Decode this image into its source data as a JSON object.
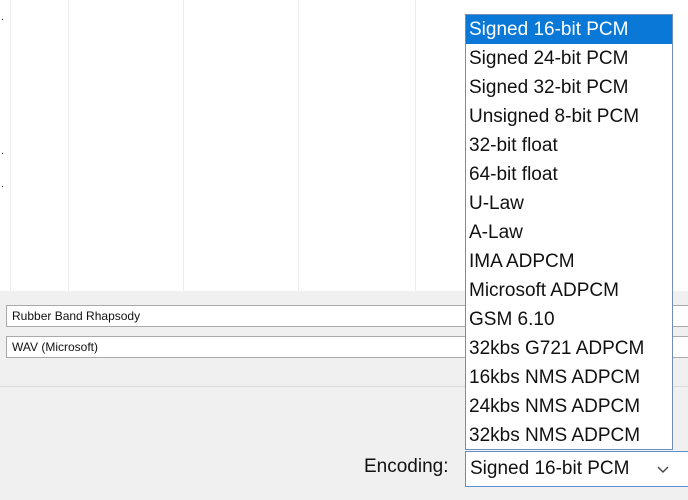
{
  "top_list": {
    "marks": [
      ".",
      ".",
      "."
    ]
  },
  "fields": {
    "name_value": "Rubber Band Rhapsody",
    "format_value": "WAV (Microsoft)"
  },
  "encoding": {
    "label": "Encoding:",
    "selected": "Signed 16-bit PCM",
    "options": [
      "Signed 16-bit PCM",
      "Signed 24-bit PCM",
      "Signed 32-bit PCM",
      "Unsigned 8-bit PCM",
      "32-bit float",
      "64-bit float",
      "U-Law",
      "A-Law",
      "IMA ADPCM",
      "Microsoft ADPCM",
      "GSM 6.10",
      "32kbs G721 ADPCM",
      "16kbs NMS ADPCM",
      "24kbs NMS ADPCM",
      "32kbs NMS ADPCM"
    ],
    "selected_index": 0
  },
  "colors": {
    "highlight": "#0a78d7",
    "focus_border": "#5b8fd0"
  },
  "icons": {
    "dropdown_arrow": "chevron-down-icon"
  }
}
